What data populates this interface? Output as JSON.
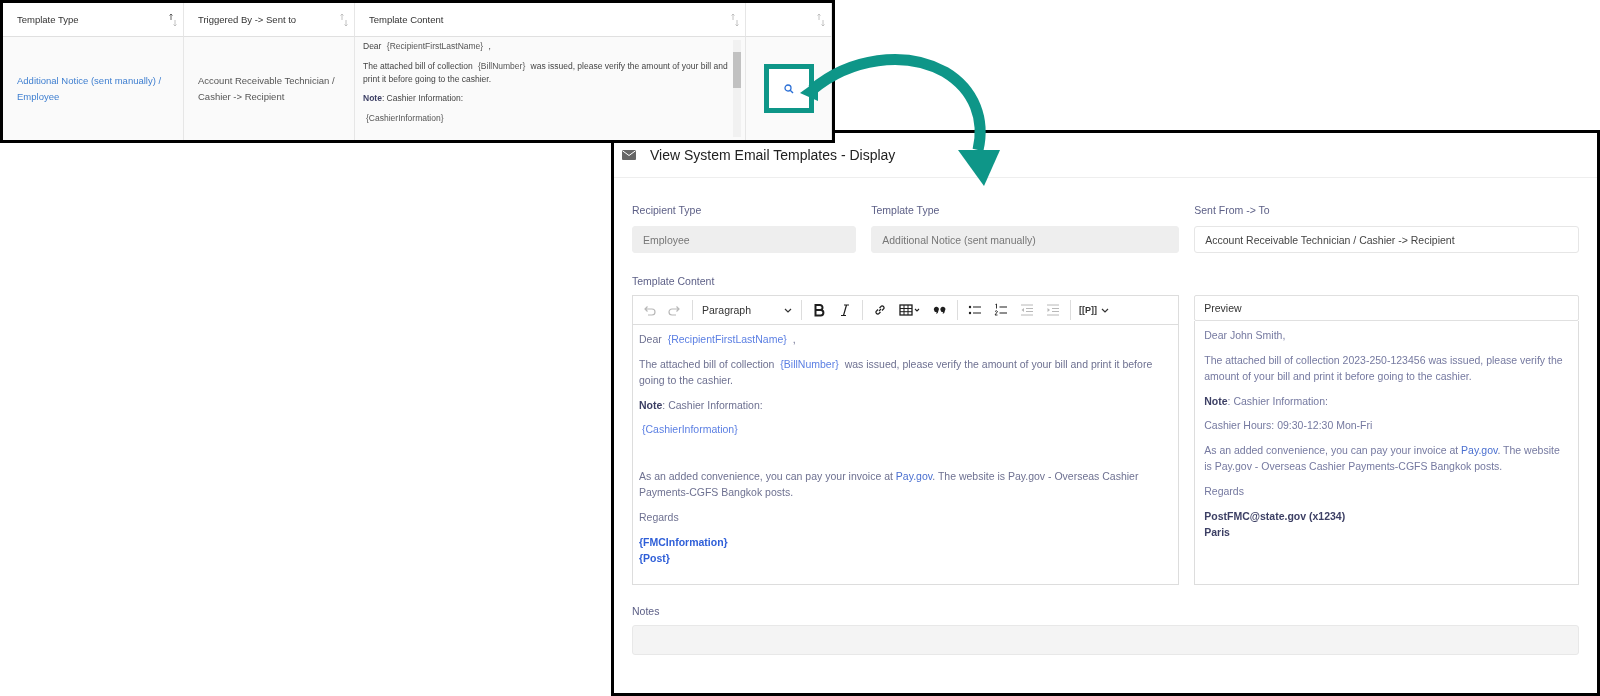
{
  "table": {
    "columns": [
      {
        "label": "Template Type",
        "sorted": true
      },
      {
        "label": "Triggered By -> Sent to",
        "sorted": false
      },
      {
        "label": "Template Content",
        "sorted": false
      },
      {
        "sorted": false
      }
    ],
    "rows": [
      {
        "template_type": "Additional Notice (sent manually) / Employee",
        "triggered_by": "Account Receivable Technician / Cashier -> Recipient",
        "content": [
          [
            {
              "kind": "plain",
              "text": "Dear "
            },
            {
              "kind": "token",
              "text": "{RecipientFirstLastName}"
            },
            {
              "kind": "plain",
              "text": " ,"
            }
          ],
          [
            {
              "kind": "plain",
              "text": "The attached bill of collection "
            },
            {
              "kind": "token",
              "text": "{BillNumber}"
            },
            {
              "kind": "plain",
              "text": " was issued, please verify the amount of your bill and print it before going to the cashier."
            }
          ],
          [
            {
              "kind": "bold",
              "text": "Note"
            },
            {
              "kind": "plain",
              "text": ": Cashier Information:"
            }
          ],
          [
            {
              "kind": "token",
              "text": "{CashierInformation}"
            }
          ]
        ],
        "view_button": {
          "highlighted": true
        }
      }
    ]
  },
  "dialog": {
    "title": "View System Email Templates - Display",
    "fields": [
      {
        "label": "Recipient Type",
        "value": "Employee",
        "readonly": true
      },
      {
        "label": "Template Type",
        "value": "Additional Notice (sent manually)",
        "readonly": true
      },
      {
        "label": "Sent From -> To",
        "value": "Account Receivable Technician / Cashier -> Recipient",
        "readonly": false
      }
    ],
    "content_label": "Template Content",
    "toolbar": [
      {
        "kind": "undo",
        "disabled": true
      },
      {
        "kind": "redo",
        "disabled": true
      },
      {
        "kind": "separator"
      },
      {
        "kind": "dropdown",
        "label": "Paragraph"
      },
      {
        "kind": "separator"
      },
      {
        "kind": "bold",
        "disabled": false
      },
      {
        "kind": "italic",
        "disabled": false
      },
      {
        "kind": "separator"
      },
      {
        "kind": "link",
        "disabled": false
      },
      {
        "kind": "table",
        "disabled": false
      },
      {
        "kind": "quote",
        "disabled": false
      },
      {
        "kind": "separator"
      },
      {
        "kind": "bullet-list",
        "disabled": false
      },
      {
        "kind": "numbered-list",
        "disabled": false
      },
      {
        "kind": "outdent",
        "disabled": true
      },
      {
        "kind": "indent",
        "disabled": true
      },
      {
        "kind": "separator"
      },
      {
        "kind": "placeholder",
        "label": "[[P]]"
      }
    ],
    "editor": [
      {
        "kind": "text",
        "segments": [
          {
            "kind": "plain",
            "text": "Dear "
          },
          {
            "kind": "token",
            "text": "{RecipientFirstLastName}"
          },
          {
            "kind": "plain",
            "text": " ,"
          }
        ]
      },
      {
        "kind": "text",
        "segments": [
          {
            "kind": "plain",
            "text": "The attached bill of collection "
          },
          {
            "kind": "token",
            "text": "{BillNumber}"
          },
          {
            "kind": "plain",
            "text": " was issued, please verify the amount of your bill and print it before going to the cashier."
          }
        ]
      },
      {
        "kind": "text",
        "segments": [
          {
            "kind": "bold",
            "text": "Note"
          },
          {
            "kind": "plain",
            "text": ": Cashier Information:"
          }
        ]
      },
      {
        "kind": "text",
        "segments": [
          {
            "kind": "token",
            "text": "{CashierInformation}"
          }
        ]
      },
      {
        "kind": "blank"
      },
      {
        "kind": "text",
        "segments": [
          {
            "kind": "plain",
            "text": "As an added convenience, you can pay your invoice at "
          },
          {
            "kind": "link",
            "text": "Pay.gov"
          },
          {
            "kind": "plain",
            "text": ". The website is Pay.gov - Overseas Cashier Payments-CGFS Bangkok posts."
          }
        ]
      },
      {
        "kind": "text",
        "segments": [
          {
            "kind": "plain",
            "text": "Regards"
          }
        ]
      },
      {
        "kind": "text",
        "segments": [
          {
            "kind": "token_bold",
            "text": "{FMCInformation}"
          },
          {
            "kind": "break"
          },
          {
            "kind": "token_bold",
            "text": "{Post}"
          }
        ]
      }
    ],
    "preview": {
      "title": "Preview",
      "paragraphs": [
        {
          "kind": "text",
          "segments": [
            {
              "kind": "plain",
              "text": "Dear John Smith,"
            }
          ]
        },
        {
          "kind": "text",
          "segments": [
            {
              "kind": "plain",
              "text": "The attached bill of collection 2023-250-123456 was issued, please verify the amount of your bill and print it before going to the cashier."
            }
          ]
        },
        {
          "kind": "text",
          "segments": [
            {
              "kind": "bold",
              "text": "Note"
            },
            {
              "kind": "plain",
              "text": ": Cashier Information:"
            }
          ]
        },
        {
          "kind": "text",
          "segments": [
            {
              "kind": "plain",
              "text": "Cashier Hours: 09:30-12:30 Mon-Fri"
            }
          ]
        },
        {
          "kind": "text",
          "segments": [
            {
              "kind": "plain",
              "text": "As an added convenience, you can pay your invoice at "
            },
            {
              "kind": "link",
              "text": "Pay.gov"
            },
            {
              "kind": "plain",
              "text": ". The website is Pay.gov - Overseas Cashier Payments-CGFS Bangkok posts."
            }
          ]
        },
        {
          "kind": "text",
          "segments": [
            {
              "kind": "plain",
              "text": "Regards"
            }
          ]
        },
        {
          "kind": "text",
          "segments": [
            {
              "kind": "bold",
              "text": "PostFMC@state.gov (x1234)"
            },
            {
              "kind": "break"
            },
            {
              "kind": "bold",
              "text": "Paris"
            }
          ]
        }
      ]
    },
    "notes_label": "Notes"
  }
}
